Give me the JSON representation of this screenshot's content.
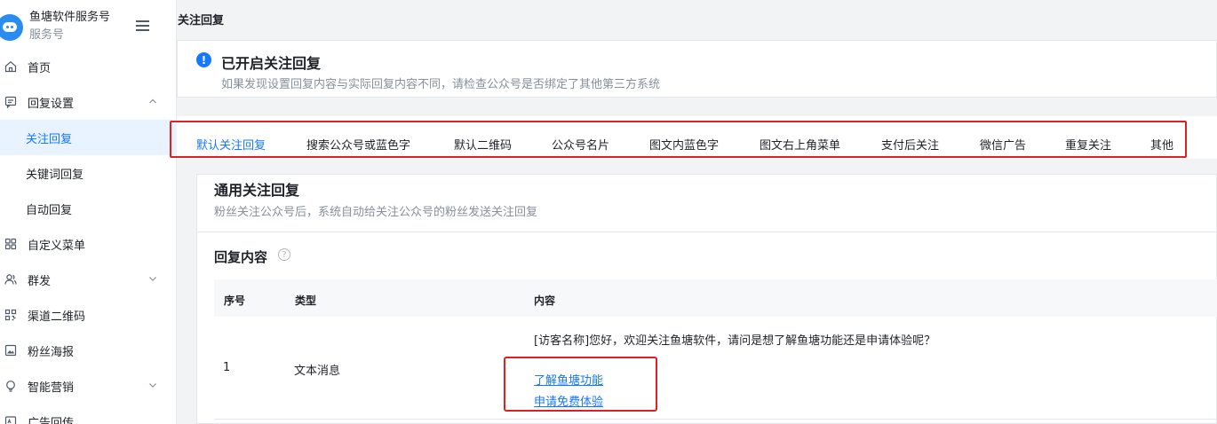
{
  "brand": {
    "name": "鱼塘软件服务号",
    "type": "服务号"
  },
  "header": {
    "title": "关注回复"
  },
  "sidebar": {
    "items": [
      {
        "label": "首页",
        "icon": "home-icon"
      },
      {
        "label": "回复设置",
        "icon": "message-icon",
        "expanded": true
      },
      {
        "label": "关注回复",
        "active": true
      },
      {
        "label": "关键词回复"
      },
      {
        "label": "自动回复"
      },
      {
        "label": "自定义菜单",
        "icon": "grid-icon"
      },
      {
        "label": "群发",
        "icon": "users-icon"
      },
      {
        "label": "渠道二维码",
        "icon": "qrcode-icon"
      },
      {
        "label": "粉丝海报",
        "icon": "poster-icon"
      },
      {
        "label": "智能营销",
        "icon": "bulb-icon"
      },
      {
        "label": "广告回传",
        "icon": "ad-icon"
      }
    ]
  },
  "notice": {
    "title": "已开启关注回复",
    "desc": "如果发现设置回复内容与实际回复内容不同，请检查公众号是否绑定了其他第三方系统"
  },
  "tabs": [
    {
      "label": "默认关注回复",
      "active": true
    },
    {
      "label": "搜索公众号或蓝色字"
    },
    {
      "label": "默认二维码"
    },
    {
      "label": "公众号名片"
    },
    {
      "label": "图文内蓝色字"
    },
    {
      "label": "图文右上角菜单"
    },
    {
      "label": "支付后关注"
    },
    {
      "label": "微信广告"
    },
    {
      "label": "重复关注"
    },
    {
      "label": "其他"
    }
  ],
  "section": {
    "title": "通用关注回复",
    "desc": "粉丝关注公众号后，系统自动给关注公众号的粉丝发送关注回复",
    "reply_title": "回复内容"
  },
  "table": {
    "headers": [
      "序号",
      "类型",
      "内容"
    ],
    "rows": [
      {
        "index": "1",
        "type": "文本消息",
        "message": "[访客名称]您好，欢迎关注鱼塘软件，请问是想了解鱼塘功能还是申请体验呢？",
        "links": [
          "了解鱼塘功能",
          "申请免费体验"
        ]
      }
    ]
  },
  "colors": {
    "accent": "#1677ff",
    "annotation": "#e02020",
    "active_bg": "#e8f3ff"
  }
}
